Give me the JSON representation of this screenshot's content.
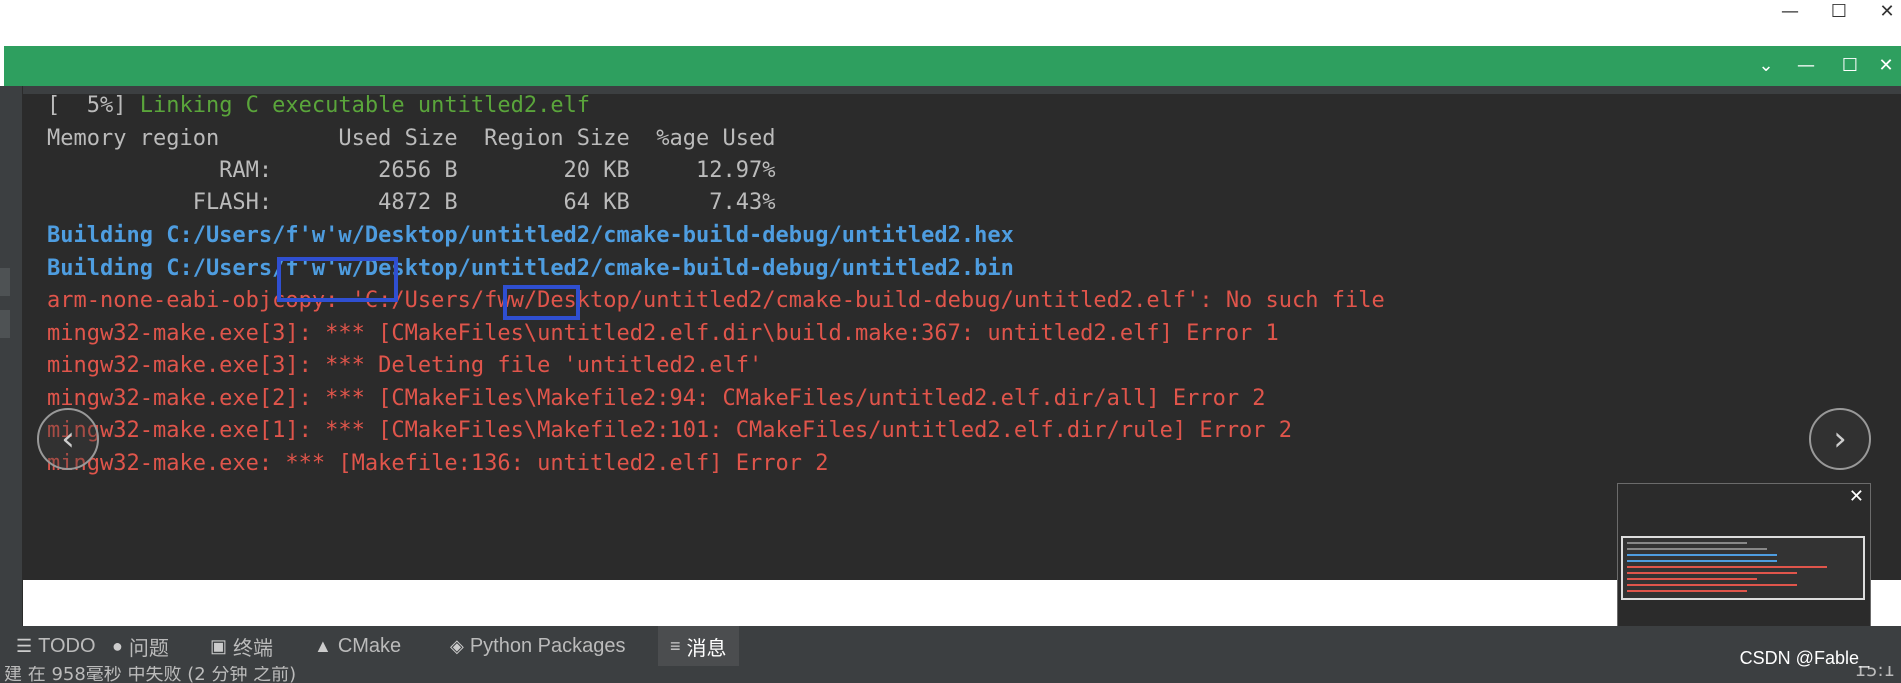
{
  "console": {
    "lines": [
      {
        "text": "[  5%] ",
        "tail": "Linking C executable untitled2.elf"
      },
      {
        "text": "Memory region         Used Size  Region Size  %age Used"
      },
      {
        "text": "             RAM:        2656 B        20 KB     12.97%"
      },
      {
        "text": "           FLASH:        4872 B        64 KB      7.43%"
      },
      {
        "text": "Building C:/Users/f'w'w/Desktop/untitled2/cmake-build-debug/untitled2.hex"
      },
      {
        "text": "Building C:/Users/f'w'w/Desktop/untitled2/cmake-build-debug/untitled2.bin"
      },
      {
        "text": "arm-none-eabi-objcopy: 'C:/Users/fww/Desktop/untitled2/cmake-build-debug/untitled2.elf': No such file"
      },
      {
        "text": "mingw32-make.exe[3]: *** [CMakeFiles\\untitled2.elf.dir\\build.make:367: untitled2.elf] Error 1"
      },
      {
        "text": "mingw32-make.exe[3]: *** Deleting file 'untitled2.elf'"
      },
      {
        "text": "mingw32-make.exe[2]: *** [CMakeFiles\\Makefile2:94: CMakeFiles/untitled2.elf.dir/all] Error 2"
      },
      {
        "text": "mingw32-make.exe[1]: *** [CMakeFiles\\Makefile2:101: CMakeFiles/untitled2.elf.dir/rule] Error 2"
      },
      {
        "text": "mingw32-make.exe: *** [Makefile:136: untitled2.elf] Error 2"
      }
    ]
  },
  "bottom_tabs": [
    {
      "label": "TODO",
      "icon": "list-icon"
    },
    {
      "label": "问题",
      "icon": "problems-icon"
    },
    {
      "label": "终端",
      "icon": "terminal-icon"
    },
    {
      "label": "CMake",
      "icon": "cmake-icon"
    },
    {
      "label": "Python Packages",
      "icon": "packages-icon"
    },
    {
      "label": "消息",
      "icon": "messages-icon"
    }
  ],
  "status_bar": {
    "left_text": "建 在 958毫秒 中失败 (2 分钟 之前)",
    "right_text": "15:1"
  },
  "watermark": "CSDN @Fable_",
  "window_controls": {
    "minimize": "—",
    "maximize": "☐",
    "close": "✕",
    "collapse": "⌄"
  },
  "nav": {
    "prev": "‹",
    "next": "›"
  },
  "colors": {
    "accent_green": "#2e9f5f",
    "console_bg": "#2b2b2b",
    "error_red": "#e0554b",
    "info_blue": "#4e9de0",
    "link_green": "#5aa53b",
    "highlight_box": "#2f4fd1"
  }
}
